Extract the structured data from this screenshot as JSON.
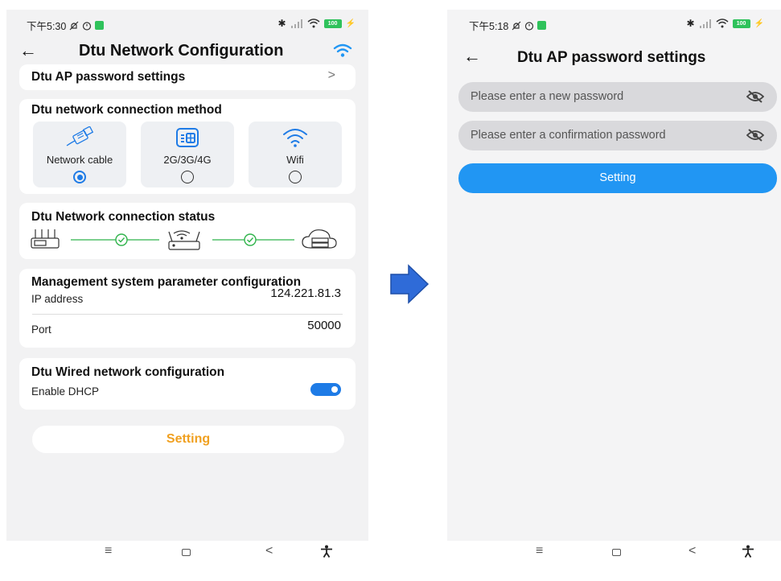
{
  "left": {
    "status": {
      "time": "下午5:30"
    },
    "header": {
      "title": "Dtu Network Configuration"
    },
    "ap_row": {
      "label": "Dtu AP password settings",
      "chevron": ">"
    },
    "method": {
      "title": "Dtu network connection method",
      "options": [
        {
          "label": "Network cable",
          "icon": "ethernet-cable-icon",
          "selected": true
        },
        {
          "label": "2G/3G/4G",
          "icon": "sim-card-icon",
          "selected": false
        },
        {
          "label": "Wifi",
          "icon": "wifi-icon",
          "selected": false
        }
      ]
    },
    "conn_status": {
      "title": "Dtu Network connection status"
    },
    "mgmt": {
      "title": "Management system parameter configuration",
      "ip_label": "IP address",
      "ip_value": "124.221.81.3",
      "port_label": "Port",
      "port_value": "50000"
    },
    "wired": {
      "title": "Dtu Wired network configuration",
      "dhcp_label": "Enable DHCP",
      "dhcp_enabled": true
    },
    "setting_button": "Setting"
  },
  "right": {
    "status": {
      "time": "下午5:18"
    },
    "header": {
      "title": "Dtu AP password settings"
    },
    "new_password_placeholder": "Please enter a new password",
    "confirm_password_placeholder": "Please enter a confirmation password",
    "setting_button": "Setting"
  },
  "nav": {
    "menu": "≡",
    "back": "<"
  },
  "colors": {
    "accent": "#1e7be6",
    "button_blue": "#2196f3",
    "setting_text": "#f0a020",
    "arrow": "#2f6bd8"
  }
}
